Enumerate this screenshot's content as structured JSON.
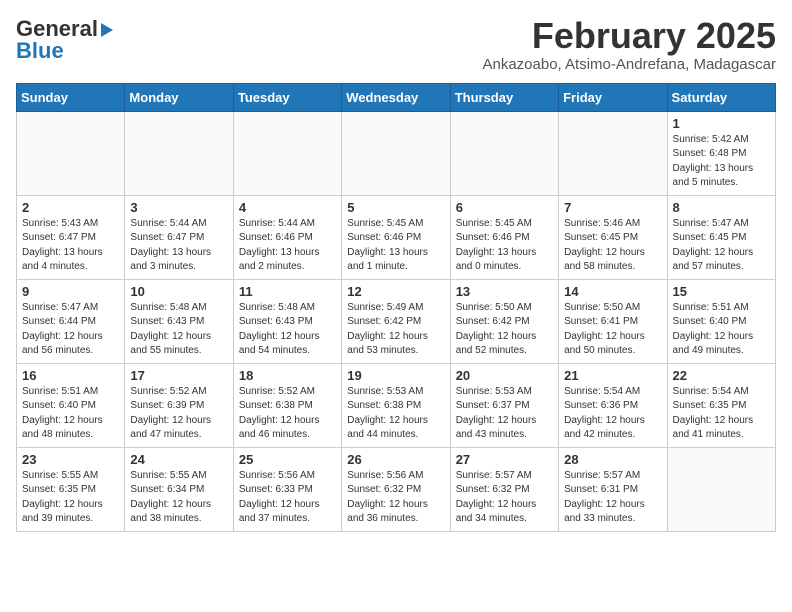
{
  "header": {
    "logo_general": "General",
    "logo_blue": "Blue",
    "month": "February 2025",
    "location": "Ankazoabo, Atsimo-Andrefana, Madagascar"
  },
  "weekdays": [
    "Sunday",
    "Monday",
    "Tuesday",
    "Wednesday",
    "Thursday",
    "Friday",
    "Saturday"
  ],
  "weeks": [
    [
      {
        "day": "",
        "info": ""
      },
      {
        "day": "",
        "info": ""
      },
      {
        "day": "",
        "info": ""
      },
      {
        "day": "",
        "info": ""
      },
      {
        "day": "",
        "info": ""
      },
      {
        "day": "",
        "info": ""
      },
      {
        "day": "1",
        "info": "Sunrise: 5:42 AM\nSunset: 6:48 PM\nDaylight: 13 hours\nand 5 minutes."
      }
    ],
    [
      {
        "day": "2",
        "info": "Sunrise: 5:43 AM\nSunset: 6:47 PM\nDaylight: 13 hours\nand 4 minutes."
      },
      {
        "day": "3",
        "info": "Sunrise: 5:44 AM\nSunset: 6:47 PM\nDaylight: 13 hours\nand 3 minutes."
      },
      {
        "day": "4",
        "info": "Sunrise: 5:44 AM\nSunset: 6:46 PM\nDaylight: 13 hours\nand 2 minutes."
      },
      {
        "day": "5",
        "info": "Sunrise: 5:45 AM\nSunset: 6:46 PM\nDaylight: 13 hours\nand 1 minute."
      },
      {
        "day": "6",
        "info": "Sunrise: 5:45 AM\nSunset: 6:46 PM\nDaylight: 13 hours\nand 0 minutes."
      },
      {
        "day": "7",
        "info": "Sunrise: 5:46 AM\nSunset: 6:45 PM\nDaylight: 12 hours\nand 58 minutes."
      },
      {
        "day": "8",
        "info": "Sunrise: 5:47 AM\nSunset: 6:45 PM\nDaylight: 12 hours\nand 57 minutes."
      }
    ],
    [
      {
        "day": "9",
        "info": "Sunrise: 5:47 AM\nSunset: 6:44 PM\nDaylight: 12 hours\nand 56 minutes."
      },
      {
        "day": "10",
        "info": "Sunrise: 5:48 AM\nSunset: 6:43 PM\nDaylight: 12 hours\nand 55 minutes."
      },
      {
        "day": "11",
        "info": "Sunrise: 5:48 AM\nSunset: 6:43 PM\nDaylight: 12 hours\nand 54 minutes."
      },
      {
        "day": "12",
        "info": "Sunrise: 5:49 AM\nSunset: 6:42 PM\nDaylight: 12 hours\nand 53 minutes."
      },
      {
        "day": "13",
        "info": "Sunrise: 5:50 AM\nSunset: 6:42 PM\nDaylight: 12 hours\nand 52 minutes."
      },
      {
        "day": "14",
        "info": "Sunrise: 5:50 AM\nSunset: 6:41 PM\nDaylight: 12 hours\nand 50 minutes."
      },
      {
        "day": "15",
        "info": "Sunrise: 5:51 AM\nSunset: 6:40 PM\nDaylight: 12 hours\nand 49 minutes."
      }
    ],
    [
      {
        "day": "16",
        "info": "Sunrise: 5:51 AM\nSunset: 6:40 PM\nDaylight: 12 hours\nand 48 minutes."
      },
      {
        "day": "17",
        "info": "Sunrise: 5:52 AM\nSunset: 6:39 PM\nDaylight: 12 hours\nand 47 minutes."
      },
      {
        "day": "18",
        "info": "Sunrise: 5:52 AM\nSunset: 6:38 PM\nDaylight: 12 hours\nand 46 minutes."
      },
      {
        "day": "19",
        "info": "Sunrise: 5:53 AM\nSunset: 6:38 PM\nDaylight: 12 hours\nand 44 minutes."
      },
      {
        "day": "20",
        "info": "Sunrise: 5:53 AM\nSunset: 6:37 PM\nDaylight: 12 hours\nand 43 minutes."
      },
      {
        "day": "21",
        "info": "Sunrise: 5:54 AM\nSunset: 6:36 PM\nDaylight: 12 hours\nand 42 minutes."
      },
      {
        "day": "22",
        "info": "Sunrise: 5:54 AM\nSunset: 6:35 PM\nDaylight: 12 hours\nand 41 minutes."
      }
    ],
    [
      {
        "day": "23",
        "info": "Sunrise: 5:55 AM\nSunset: 6:35 PM\nDaylight: 12 hours\nand 39 minutes."
      },
      {
        "day": "24",
        "info": "Sunrise: 5:55 AM\nSunset: 6:34 PM\nDaylight: 12 hours\nand 38 minutes."
      },
      {
        "day": "25",
        "info": "Sunrise: 5:56 AM\nSunset: 6:33 PM\nDaylight: 12 hours\nand 37 minutes."
      },
      {
        "day": "26",
        "info": "Sunrise: 5:56 AM\nSunset: 6:32 PM\nDaylight: 12 hours\nand 36 minutes."
      },
      {
        "day": "27",
        "info": "Sunrise: 5:57 AM\nSunset: 6:32 PM\nDaylight: 12 hours\nand 34 minutes."
      },
      {
        "day": "28",
        "info": "Sunrise: 5:57 AM\nSunset: 6:31 PM\nDaylight: 12 hours\nand 33 minutes."
      },
      {
        "day": "",
        "info": ""
      }
    ]
  ]
}
